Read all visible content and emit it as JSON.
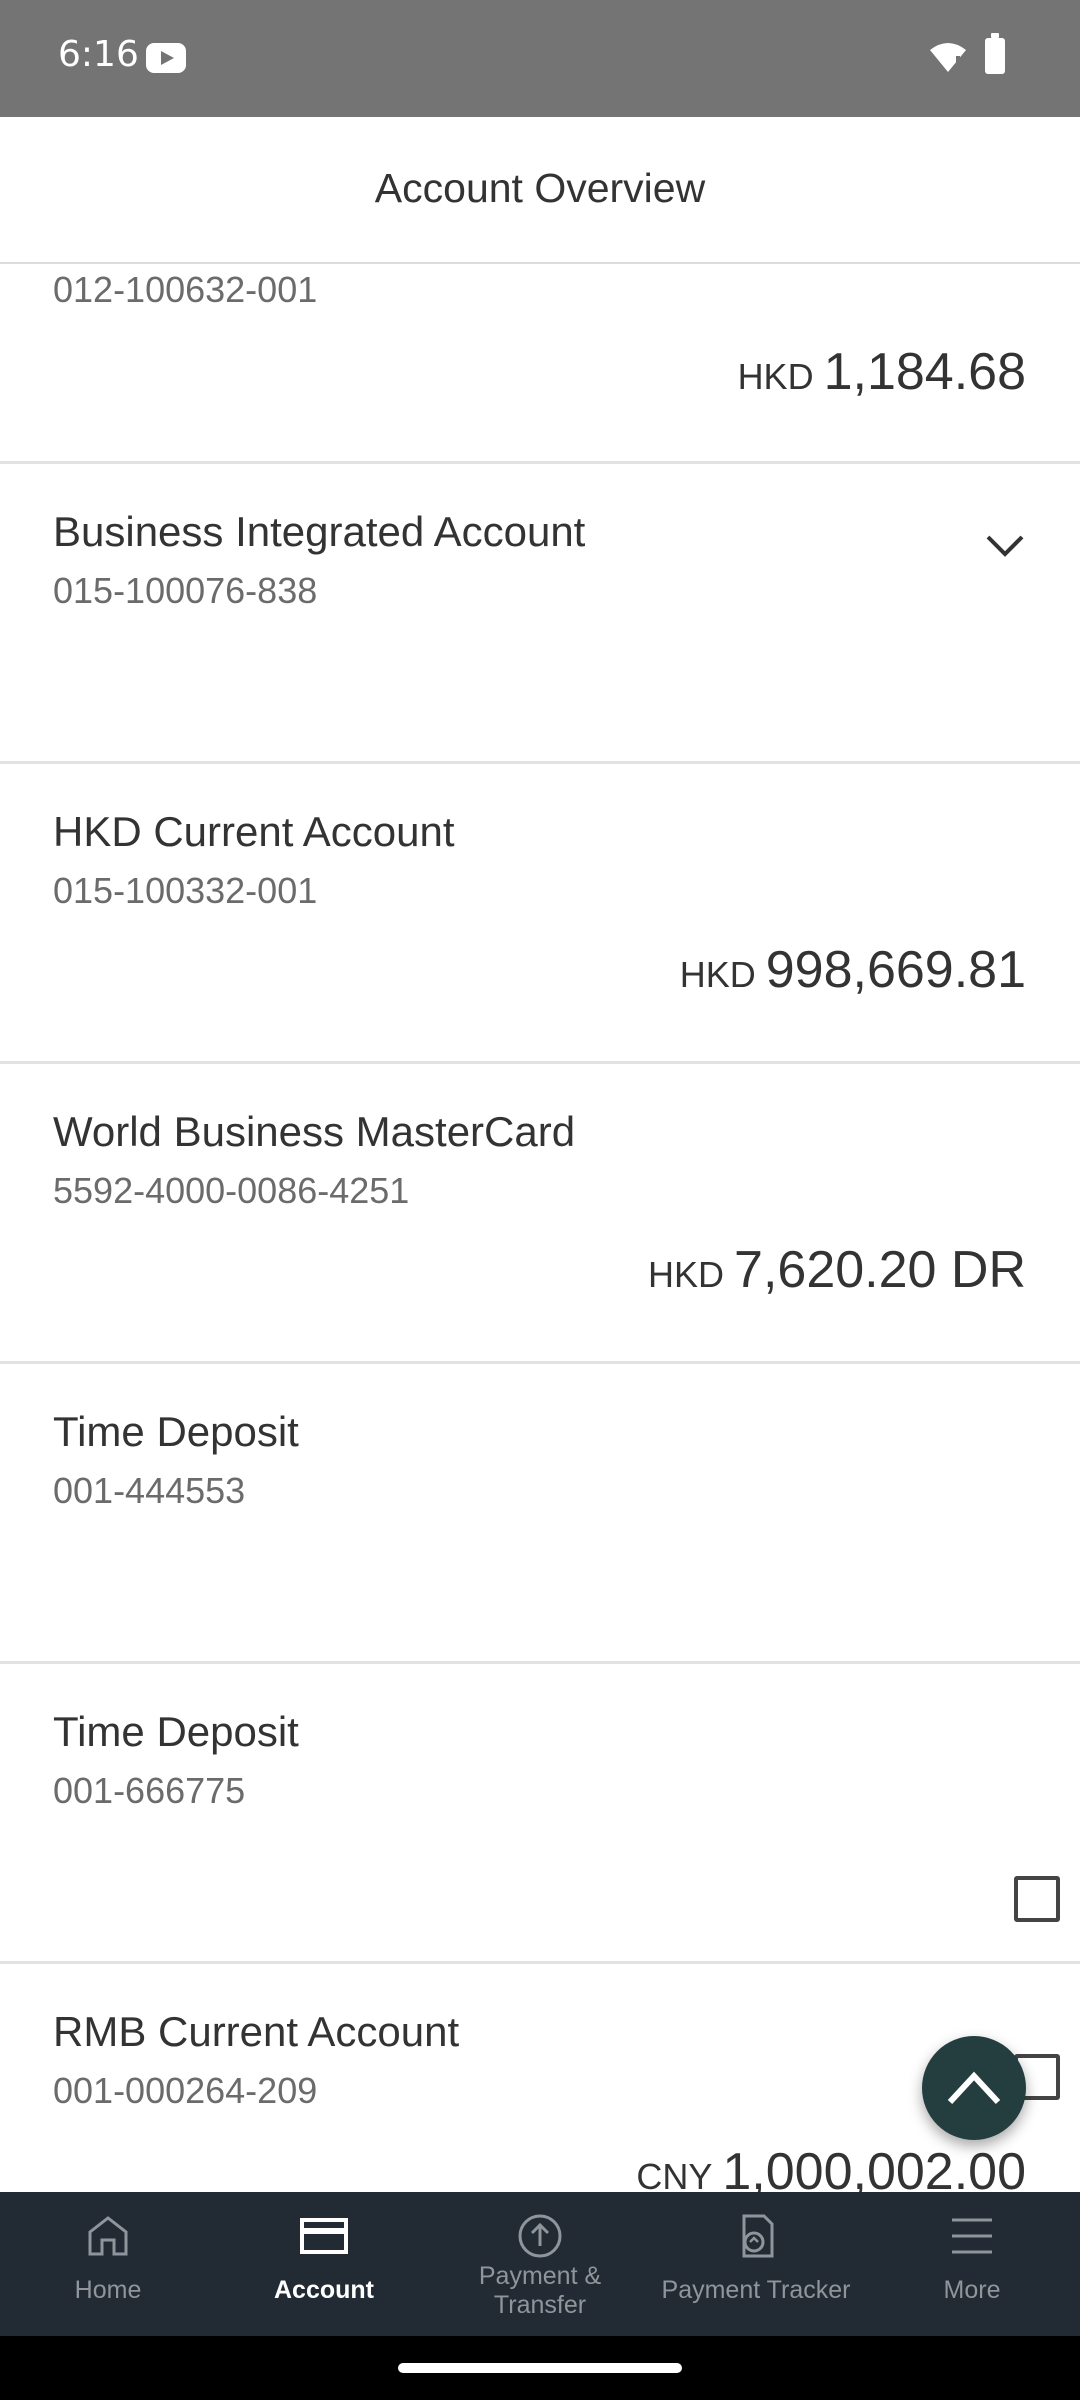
{
  "status_bar": {
    "time": "6:16"
  },
  "header": {
    "title": "Account Overview"
  },
  "accounts": [
    {
      "name": "",
      "number": "012-100632-001",
      "currency": "HKD",
      "amount": "1,184.68"
    },
    {
      "name": "Business Integrated Account",
      "number": "015-100076-838",
      "currency": "",
      "amount": ""
    },
    {
      "name": "HKD Current Account",
      "number": "015-100332-001",
      "currency": "HKD",
      "amount": "998,669.81"
    },
    {
      "name": "World Business MasterCard",
      "number": "5592-4000-0086-4251",
      "currency": "HKD",
      "amount": "7,620.20 DR"
    },
    {
      "name": "Time Deposit",
      "number": "001-444553",
      "currency": "",
      "amount": ""
    },
    {
      "name": "Time Deposit",
      "number": "001-666775",
      "currency": "",
      "amount": ""
    },
    {
      "name": "RMB Current Account",
      "number": "001-000264-209",
      "currency": "CNY",
      "amount": "1,000,002.00"
    }
  ],
  "bottom_nav": {
    "items": [
      {
        "label": "Home",
        "icon": "home-icon",
        "active": false
      },
      {
        "label": "Account",
        "icon": "card-icon",
        "active": true
      },
      {
        "label_line1": "Payment &",
        "label_line2": "Transfer",
        "icon": "upload-circle-icon",
        "active": false
      },
      {
        "label": "Payment Tracker",
        "icon": "document-upload-icon",
        "active": false
      },
      {
        "label": "More",
        "icon": "menu-icon",
        "active": false
      }
    ]
  },
  "colors": {
    "status_bar": "#747474",
    "nav_background": "#222b33",
    "fab": "#243d3f",
    "divider": "#e2e2e2"
  }
}
